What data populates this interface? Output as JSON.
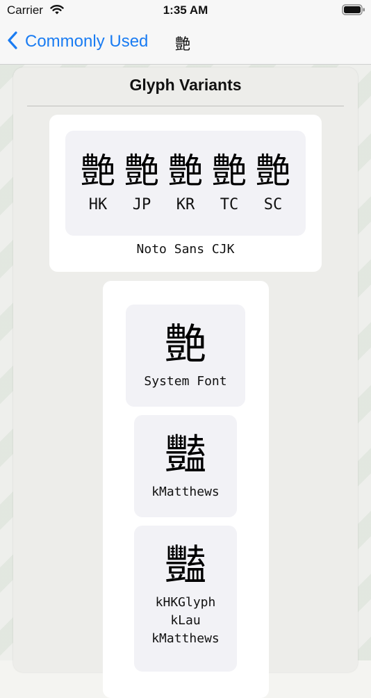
{
  "status_bar": {
    "carrier": "Carrier",
    "time": "1:35 AM"
  },
  "nav": {
    "back_label": "Commonly Used",
    "title": "艶"
  },
  "card": {
    "title": "Glyph Variants",
    "noto": {
      "variants": [
        {
          "glyph": "艶",
          "label": "HK"
        },
        {
          "glyph": "艶",
          "label": "JP"
        },
        {
          "glyph": "艶",
          "label": "KR"
        },
        {
          "glyph": "艶",
          "label": "TC"
        },
        {
          "glyph": "艶",
          "label": "SC"
        }
      ],
      "font_name": "Noto Sans CJK"
    },
    "system": {
      "glyph": "艶",
      "caption": "System Font"
    },
    "matthews": {
      "glyph": "豔",
      "caption": "kMatthews"
    },
    "hk": {
      "glyph": "豔",
      "captions": [
        "kHKGlyph",
        "kLau",
        "kMatthews"
      ]
    }
  },
  "colors": {
    "accent": "#1a7cf2",
    "tile_bg": "#f2f2f6",
    "card_bg": "#ededea"
  }
}
